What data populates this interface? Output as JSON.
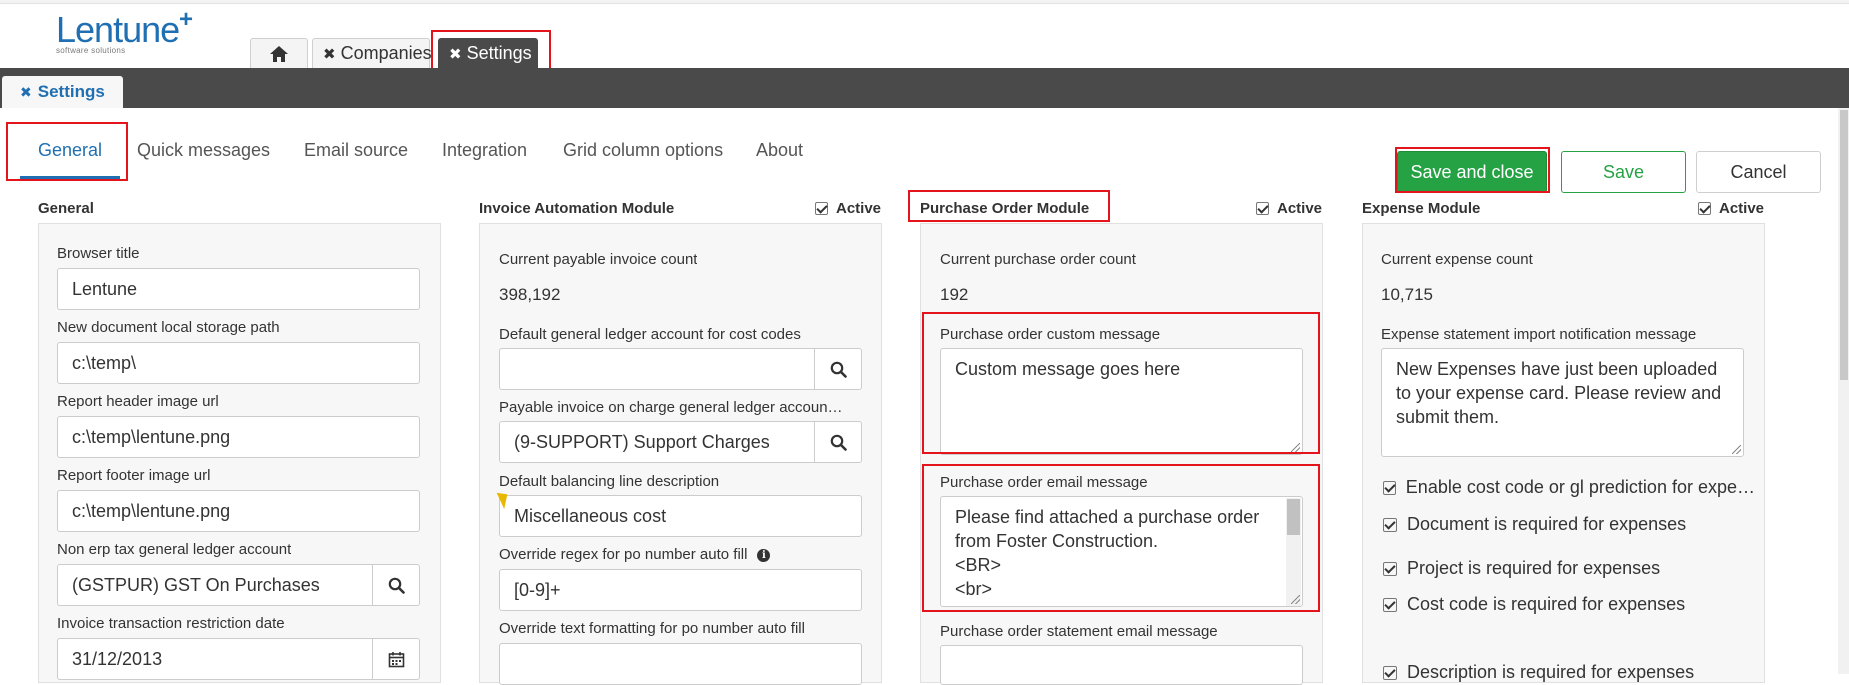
{
  "app": {
    "logo_text": "Lentune",
    "logo_sub": "software solutions"
  },
  "top_tabs": {
    "home_icon": "home-icon",
    "companies": "Companies",
    "settings": "Settings"
  },
  "page_tab": "Settings",
  "sub_tabs": [
    "General",
    "Quick messages",
    "Email source",
    "Integration",
    "Grid column options",
    "About"
  ],
  "actions": {
    "save_and_close": "Save and close",
    "save": "Save",
    "cancel": "Cancel"
  },
  "general": {
    "title": "General",
    "browser_title_label": "Browser title",
    "browser_title_value": "Lentune",
    "storage_path_label": "New document local storage path",
    "storage_path_value": "c:\\temp\\",
    "header_img_label": "Report header image url",
    "header_img_value": "c:\\temp\\lentune.png",
    "footer_img_label": "Report footer image url",
    "footer_img_value": "c:\\temp\\lentune.png",
    "tax_gl_label": "Non erp tax general ledger account",
    "tax_gl_value": "(GSTPUR) GST On Purchases",
    "restriction_date_label": "Invoice transaction restriction date",
    "restriction_date_value": "31/12/2013"
  },
  "invoice": {
    "title": "Invoice Automation Module",
    "active_label": "Active",
    "count_label": "Current payable invoice count",
    "count_value": "398,192",
    "default_gl_label": "Default general ledger account for cost codes",
    "default_gl_value": "",
    "on_charge_label": "Payable invoice on charge general ledger accoun…",
    "on_charge_value": "(9-SUPPORT) Support Charges",
    "balancing_label": "Default balancing line description",
    "balancing_value": "Miscellaneous cost",
    "regex_label": "Override regex for po number auto fill",
    "regex_value": "[0-9]+",
    "text_format_label": "Override text formatting for po number auto fill",
    "text_format_value": ""
  },
  "purchase_order": {
    "title": "Purchase Order Module",
    "active_label": "Active",
    "count_label": "Current purchase order count",
    "count_value": "192",
    "custom_msg_label": "Purchase order custom message",
    "custom_msg_value": "Custom message goes here",
    "email_msg_label": "Purchase order email message",
    "email_msg_lines": [
      "Please find attached a purchase order",
      "from Foster Construction.",
      "<BR>",
      "<br>"
    ],
    "statement_email_label": "Purchase order statement email message"
  },
  "expense": {
    "title": "Expense Module",
    "active_label": "Active",
    "count_label": "Current expense count",
    "count_value": "10,715",
    "notify_label": "Expense statement import notification message",
    "notify_lines": [
      "New Expenses have just been uploaded",
      "to your expense card. Please review and",
      "submit them."
    ],
    "checks": [
      "Enable cost code or gl prediction for expe…",
      "Document is required for expenses",
      "Project is required for expenses",
      "Cost code is required for expenses",
      "Description is required for expenses"
    ]
  },
  "colors": {
    "brand_blue": "#1f6fb2",
    "dark_bar": "#4a4a4a",
    "primary_green": "#25a244",
    "highlight_red": "#e3141c"
  }
}
